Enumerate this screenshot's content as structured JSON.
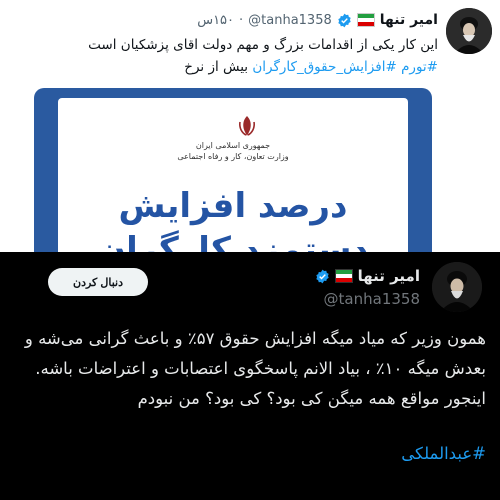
{
  "top_tweet": {
    "author_name": "امیر تنها",
    "handle": "@tanha1358",
    "time": "۱۵۰س",
    "separator": "·",
    "text_line1": "این کار یکی از اقدامات بزرگ و مهم دولت اقای پزشکیان است",
    "text_line2_hashtag1": "#تورم",
    "text_line2_hashtag2": "#افزایش_حقوق_کارگران",
    "text_line2_plain": "بیش از نرخ",
    "media": {
      "ministry_line1": "جمهوری اسلامی ایران",
      "ministry_line2": "وزارت تعاون، کار و رفاه اجتماعی",
      "headline_line1": "درصد افزایش",
      "headline_line2": "دستمزد کارگران"
    }
  },
  "bottom_tweet": {
    "author_name": "امیر تنها",
    "handle": "@tanha1358",
    "follow_label": "دنبال کردن",
    "body": "همون وزیر که میاد میگه افزایش حقوق ۵۷٪ و باعث گرانی می‌شه و بعدش میگه ۱۰٪ ، بیاد الانم پاسخگوی اعتصابات و اعتراضات باشه. اینجور مواقع همه میگن کی بود؟ کی بود؟ من نبودم",
    "hashtag": "#عبدالملکی"
  },
  "colors": {
    "link_blue": "#1d9bf0",
    "verified_blue": "#1d9bf0",
    "media_blue": "#2454a4",
    "dark_bg": "#000000",
    "flag_green": "#239f40",
    "flag_red": "#da0000"
  }
}
